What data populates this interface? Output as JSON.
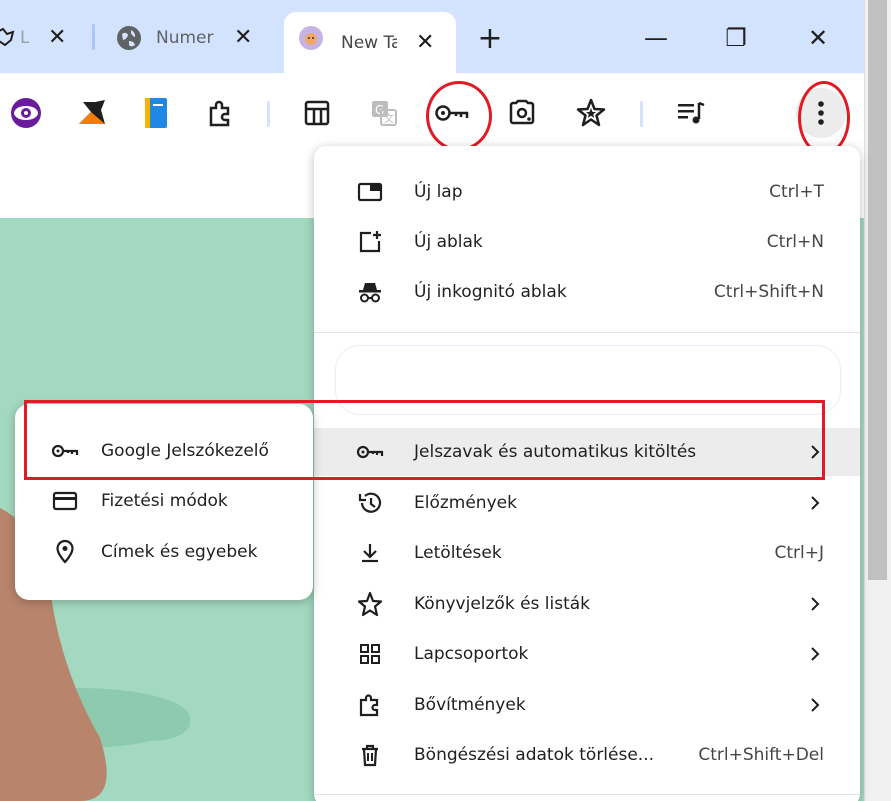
{
  "tabs": [
    {
      "label": "L",
      "icon": "extension-favicon-icon",
      "active": false
    },
    {
      "label": "Numer",
      "icon": "globe-icon",
      "active": false
    },
    {
      "label": "New Ta",
      "icon": "cat-favicon-icon",
      "active": true
    }
  ],
  "new_tab_symbol": "+",
  "window_controls": {
    "minimize": "—",
    "restore": "❐",
    "close": "✕"
  },
  "toolbar_icons": [
    "eye-extension-icon",
    "arrow-extension-icon",
    "notebook-extension-icon",
    "puzzle-extensions-icon",
    "sidebar-panel-icon",
    "translate-icon",
    "password-key-icon",
    "google-lens-icon",
    "bookmark-star-icon",
    "reading-list-icon",
    "more-menu-icon"
  ],
  "menu": {
    "items": [
      {
        "label": "Új lap",
        "shortcut": "Ctrl+T",
        "icon": "new-tab-icon"
      },
      {
        "label": "Új ablak",
        "shortcut": "Ctrl+N",
        "icon": "new-window-icon"
      },
      {
        "label": "Új inkognitó ablak",
        "shortcut": "Ctrl+Shift+N",
        "icon": "incognito-icon"
      },
      {
        "label": "Jelszavak és automatikus kitöltés",
        "shortcut": "",
        "icon": "key-icon",
        "submenu": true
      },
      {
        "label": "Előzmények",
        "shortcut": "",
        "icon": "history-icon",
        "submenu": true
      },
      {
        "label": "Letöltések",
        "shortcut": "Ctrl+J",
        "icon": "download-icon"
      },
      {
        "label": "Könyvjelzők és listák",
        "shortcut": "",
        "icon": "star-icon",
        "submenu": true
      },
      {
        "label": "Lapcsoportok",
        "shortcut": "",
        "icon": "grid-icon",
        "submenu": true
      },
      {
        "label": "Bővítmények",
        "shortcut": "",
        "icon": "puzzle-icon",
        "submenu": true
      },
      {
        "label": "Böngészési adatok törlése...",
        "shortcut": "Ctrl+Shift+Del",
        "icon": "trash-icon"
      }
    ]
  },
  "submenu": {
    "items": [
      {
        "label": "Google Jelszókezelő",
        "icon": "key-icon"
      },
      {
        "label": "Fizetési módok",
        "icon": "credit-card-icon"
      },
      {
        "label": "Címek és egyebek",
        "icon": "location-pin-icon"
      }
    ]
  },
  "colors": {
    "tabstrip": "#d3e3fd",
    "page_background": "#a3d9c1",
    "annotation_red": "#e01b24",
    "highlight": "#ececec"
  }
}
